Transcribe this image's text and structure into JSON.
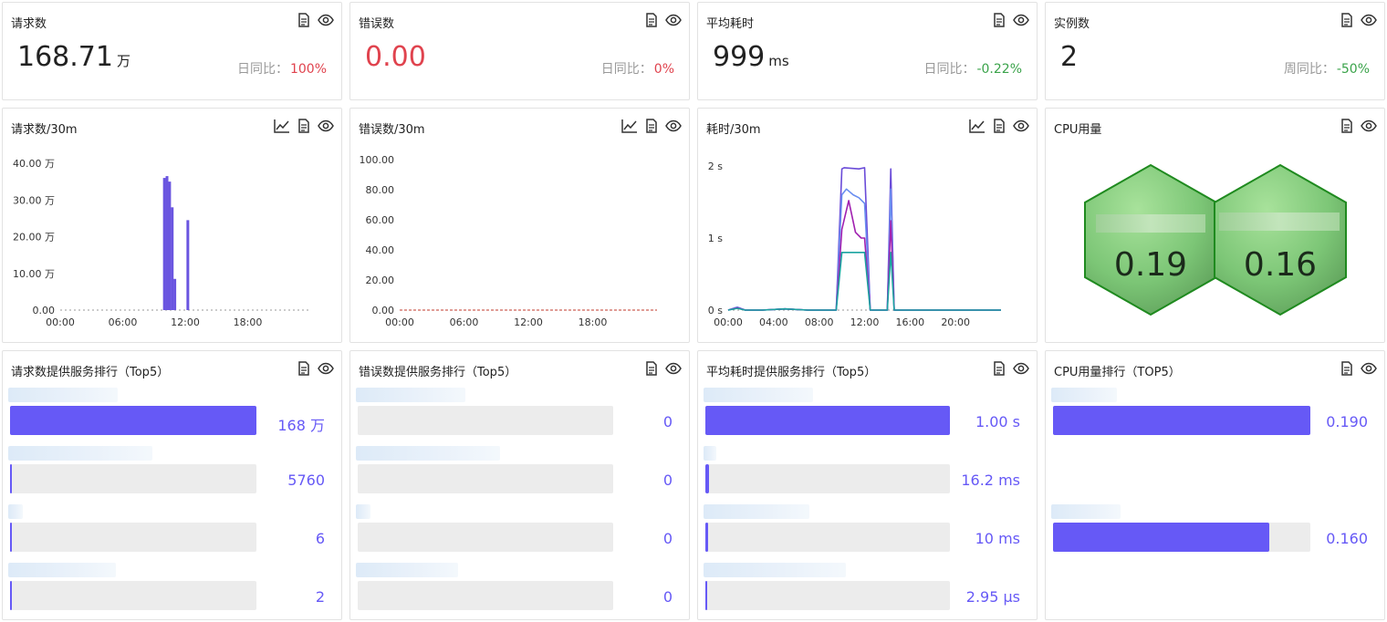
{
  "stats": [
    {
      "title": "请求数",
      "value": "168.71",
      "unit": "万",
      "cmp_label": "日同比：",
      "cmp_value": "100%",
      "value_color": "#222222",
      "cmp_color": "#e0434e"
    },
    {
      "title": "错误数",
      "value": "0.00",
      "unit": "",
      "cmp_label": "日同比：",
      "cmp_value": "0%",
      "value_color": "#e0434e",
      "cmp_color": "#e0434e"
    },
    {
      "title": "平均耗时",
      "value": "999",
      "unit": "ms",
      "cmp_label": "日同比：",
      "cmp_value": "-0.22%",
      "value_color": "#222222",
      "cmp_color": "#3aa34a"
    },
    {
      "title": "实例数",
      "value": "2",
      "unit": "",
      "cmp_label": "周同比：",
      "cmp_value": "-50%",
      "value_color": "#222222",
      "cmp_color": "#3aa34a"
    }
  ],
  "charts": {
    "requests": {
      "title": "请求数/30m"
    },
    "errors": {
      "title": "错误数/30m"
    },
    "latency": {
      "title": "耗时/30m"
    },
    "cpu": {
      "title": "CPU用量"
    }
  },
  "chart_data": [
    {
      "type": "bar",
      "title": "请求数/30m",
      "x_ticks": [
        "00:00",
        "06:00",
        "12:00",
        "18:00"
      ],
      "y_ticks": [
        "0.00",
        "10.00 万",
        "20.00 万",
        "30.00 万",
        "40.00 万"
      ],
      "ylim": [
        0,
        40
      ],
      "xlim": [
        0,
        24
      ],
      "x": [
        10.0,
        10.25,
        10.5,
        10.75,
        11.0,
        12.25
      ],
      "values": [
        36,
        36.5,
        35,
        28,
        8.5,
        24.5
      ],
      "color": "#6a55e0"
    },
    {
      "type": "line",
      "title": "错误数/30m",
      "x_ticks": [
        "00:00",
        "06:00",
        "12:00",
        "18:00"
      ],
      "y_ticks": [
        "0.00",
        "20.00",
        "40.00",
        "60.00",
        "80.00",
        "100.00"
      ],
      "ylim": [
        0,
        100
      ],
      "xlim": [
        0,
        24
      ],
      "series": [
        {
          "x": [
            0,
            24
          ],
          "y": [
            0,
            0
          ],
          "color": "#c0392b"
        }
      ]
    },
    {
      "type": "line",
      "title": "耗时/30m",
      "x_ticks": [
        "00:00",
        "04:00",
        "08:00",
        "12:00",
        "16:00",
        "20:00"
      ],
      "y_ticks": [
        "0 s",
        "1 s",
        "2 s"
      ],
      "ylim": [
        0,
        2.5
      ],
      "xlim": [
        0,
        24
      ],
      "series": [
        {
          "color": "#6a4bd8",
          "x": [
            0,
            0.8,
            1.5,
            3,
            5,
            7,
            9.5,
            10,
            10.2,
            11.5,
            12,
            12.5,
            13,
            14,
            14.3,
            14.6,
            15,
            16,
            24
          ],
          "y": [
            0,
            0.05,
            0,
            0,
            0.02,
            0,
            0,
            2.45,
            2.47,
            2.45,
            2.47,
            0,
            0,
            0,
            2.45,
            0,
            0,
            0,
            0
          ]
        },
        {
          "color": "#6a8ef0",
          "x": [
            0,
            0.8,
            1.5,
            3,
            5,
            7,
            9.5,
            10,
            10.4,
            11,
            11.5,
            12,
            12.5,
            13,
            14,
            14.3,
            14.6,
            15,
            16,
            24
          ],
          "y": [
            0,
            0.05,
            0,
            0,
            0.02,
            0,
            0,
            2.0,
            2.1,
            2.0,
            1.95,
            1.85,
            0,
            0,
            0,
            2.1,
            0,
            0,
            0,
            0
          ]
        },
        {
          "color": "#a020b0",
          "x": [
            0,
            0.8,
            1.5,
            3,
            5,
            7,
            9.5,
            10,
            10.6,
            11.2,
            11.7,
            12,
            12.5,
            13,
            14,
            14.3,
            14.6,
            15,
            16,
            24
          ],
          "y": [
            0,
            0.04,
            0,
            0,
            0.02,
            0,
            0,
            1.4,
            1.9,
            1.35,
            1.25,
            1.25,
            0,
            0,
            0,
            1.55,
            0,
            0,
            0,
            0
          ]
        },
        {
          "color": "#1aa3a0",
          "x": [
            0,
            0.8,
            1.5,
            3,
            5,
            7,
            9.5,
            10,
            10.4,
            11.5,
            12,
            12.5,
            13,
            14,
            14.3,
            14.6,
            15,
            16,
            24
          ],
          "y": [
            0,
            0.03,
            0,
            0,
            0.02,
            0,
            0,
            1.0,
            1.0,
            1.0,
            1.0,
            0,
            0,
            0,
            1.0,
            0,
            0,
            0,
            0
          ]
        }
      ]
    }
  ],
  "cpu_hex": [
    {
      "value": "0.19"
    },
    {
      "value": "0.16"
    }
  ],
  "ranks": {
    "requests": {
      "title": "请求数提供服务排行（Top5）",
      "rows": [
        {
          "value": "168 万",
          "fraction": 1.0,
          "label_width": 120
        },
        {
          "value": "5760",
          "fraction": 0.003,
          "label_width": 158
        },
        {
          "value": "6",
          "fraction": 0.002,
          "label_width": 16
        },
        {
          "value": "2",
          "fraction": 0.002,
          "label_width": 118
        }
      ]
    },
    "errors": {
      "title": "错误数提供服务排行（Top5）",
      "rows": [
        {
          "value": "0",
          "fraction": 0,
          "label_width": 120
        },
        {
          "value": "0",
          "fraction": 0,
          "label_width": 158
        },
        {
          "value": "0",
          "fraction": 0,
          "label_width": 16
        },
        {
          "value": "0",
          "fraction": 0,
          "label_width": 112
        }
      ]
    },
    "latency": {
      "title": "平均耗时提供服务排行（Top5）",
      "rows": [
        {
          "value": "1.00 s",
          "fraction": 1.0,
          "label_width": 120
        },
        {
          "value": "16.2 ms",
          "fraction": 0.016,
          "label_width": 14
        },
        {
          "value": "10 ms",
          "fraction": 0.01,
          "label_width": 116
        },
        {
          "value": "2.95 μs",
          "fraction": 0.001,
          "label_width": 156
        }
      ]
    },
    "cpu": {
      "title": "CPU用量排行（TOP5）",
      "rows": [
        {
          "value": "0.190",
          "fraction": 1.0,
          "label_width": 72
        },
        {
          "value": "0.160",
          "fraction": 0.84,
          "label_width": 76
        }
      ]
    }
  },
  "colors": {
    "accent": "#6659f6",
    "hex_fill": "#7fc97a",
    "hex_border": "#2a8a2a"
  }
}
